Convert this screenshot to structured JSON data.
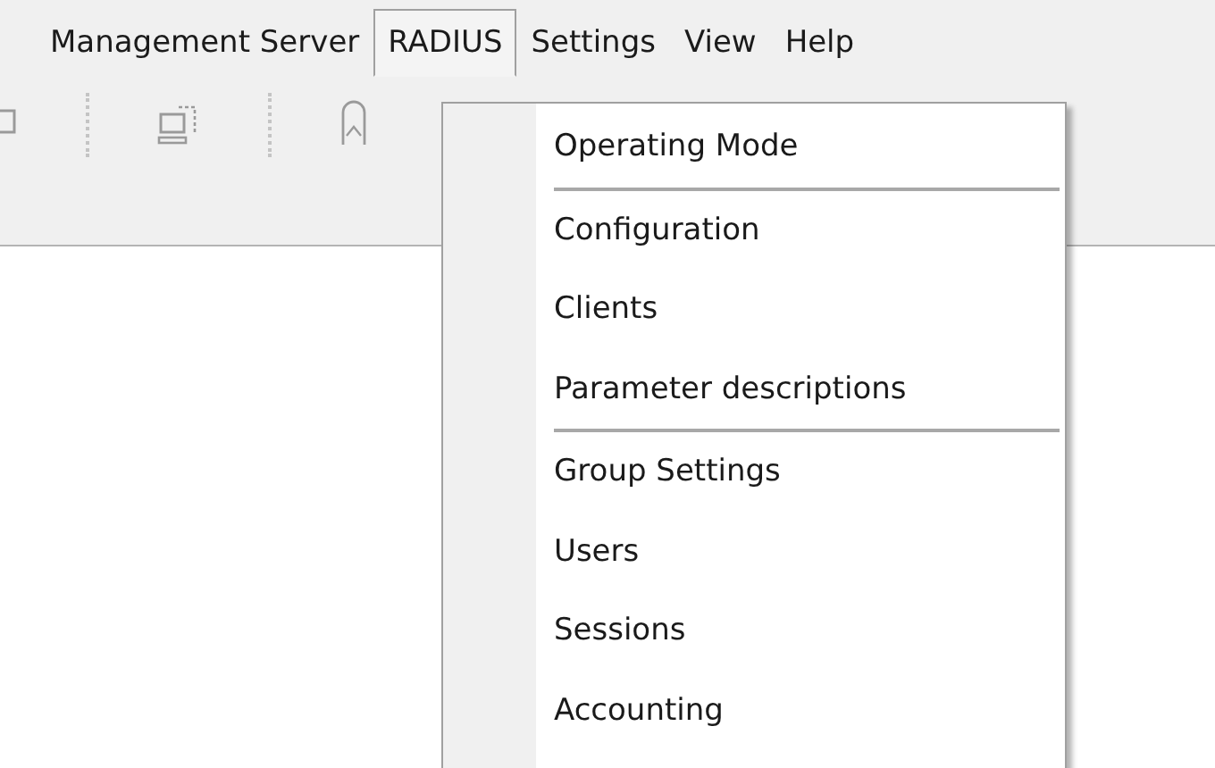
{
  "menu_bar": [
    {
      "label": "Management Server",
      "selected": false
    },
    {
      "label": "RADIUS",
      "selected": true
    },
    {
      "label": "Settings",
      "selected": false
    },
    {
      "label": "View",
      "selected": false
    },
    {
      "label": "Help",
      "selected": false
    }
  ],
  "dropdown": [
    {
      "kind": "item",
      "label": "Operating Mode"
    },
    {
      "kind": "separator"
    },
    {
      "kind": "item",
      "label": "Configuration"
    },
    {
      "kind": "item",
      "label": "Clients"
    },
    {
      "kind": "item",
      "label": "Parameter descriptions"
    },
    {
      "kind": "separator"
    },
    {
      "kind": "item",
      "label": "Group Settings"
    },
    {
      "kind": "item",
      "label": "Users"
    },
    {
      "kind": "item",
      "label": "Sessions"
    },
    {
      "kind": "item",
      "label": "Accounting"
    }
  ]
}
